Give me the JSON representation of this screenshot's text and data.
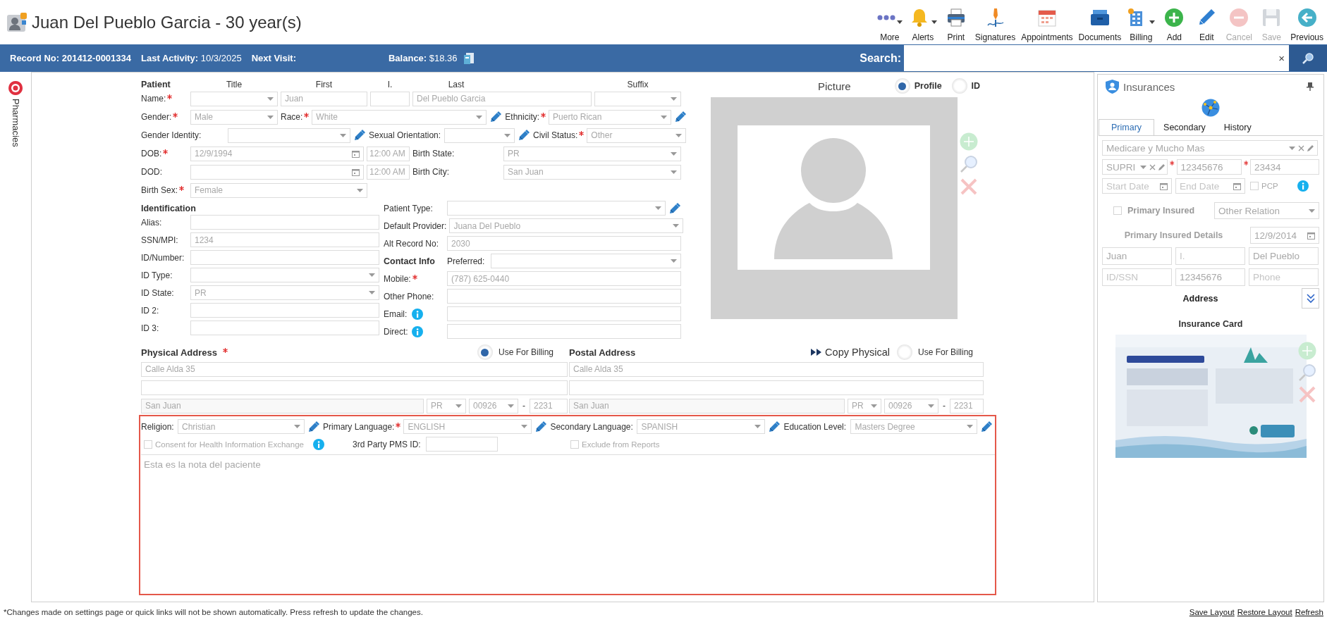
{
  "fields_disabled": true,
  "header": {
    "title": "Juan Del Pueblo Garcia - 30 year(s)"
  },
  "toolbar": [
    {
      "label": "More",
      "kind": "more",
      "dropdown": true,
      "disabled": false
    },
    {
      "label": "Alerts",
      "kind": "alerts",
      "dropdown": true,
      "disabled": false
    },
    {
      "label": "Print",
      "kind": "print",
      "dropdown": false,
      "disabled": false
    },
    {
      "label": "Signatures",
      "kind": "signatures",
      "dropdown": false,
      "disabled": false
    },
    {
      "label": "Appointments",
      "kind": "appointments",
      "dropdown": false,
      "disabled": false
    },
    {
      "label": "Documents",
      "kind": "documents",
      "dropdown": false,
      "disabled": false
    },
    {
      "label": "Billing",
      "kind": "billing",
      "dropdown": true,
      "disabled": false
    },
    {
      "label": "Add",
      "kind": "add",
      "dropdown": false,
      "disabled": false
    },
    {
      "label": "Edit",
      "kind": "edit",
      "dropdown": false,
      "disabled": false
    },
    {
      "label": "Cancel",
      "kind": "cancel",
      "dropdown": false,
      "disabled": true
    },
    {
      "label": "Save",
      "kind": "save",
      "dropdown": false,
      "disabled": true
    },
    {
      "label": "Previous",
      "kind": "previous",
      "dropdown": false,
      "disabled": false
    }
  ],
  "info_bar": {
    "record": {
      "label": "Record No:",
      "value": "201412-0001334"
    },
    "last_activity": {
      "label": "Last Activity:",
      "value": "10/3/2025"
    },
    "next_visit": {
      "label": "Next Visit:"
    },
    "balance": {
      "label": "Balance:",
      "value": "$18.36"
    },
    "search": {
      "label": "Search:",
      "clear": "×"
    }
  },
  "side_rail": {
    "label": "Pharmacies"
  },
  "patient": {
    "heading": "Patient",
    "columns": [
      "Title",
      "First",
      "I.",
      "Last",
      "Suffix"
    ],
    "name": {
      "label": "Name:",
      "required": true,
      "fields": [
        {
          "kind": "select"
        },
        {
          "kind": "input",
          "value": "Juan"
        },
        {
          "kind": "input"
        },
        {
          "kind": "input",
          "value": "Del Pueblo Garcia"
        },
        {
          "kind": "select"
        }
      ]
    },
    "rows": [
      [
        {
          "kind": "label",
          "text": "Gender:",
          "required": true
        },
        {
          "kind": "select",
          "value": "Male"
        },
        {
          "kind": "label",
          "text": "Race:",
          "required": true
        },
        {
          "kind": "select",
          "value": "White"
        },
        {
          "kind": "edit"
        },
        {
          "kind": "label",
          "text": "Ethnicity:",
          "required": true
        },
        {
          "kind": "select",
          "value": "Puerto Rican"
        },
        {
          "kind": "edit"
        }
      ],
      [
        {
          "kind": "label",
          "text": "Gender Identity:",
          "required": false
        },
        {
          "kind": "select"
        },
        {
          "kind": "edit"
        },
        {
          "kind": "label",
          "text": "Sexual Orientation:",
          "required": false
        },
        {
          "kind": "select"
        },
        {
          "kind": "edit"
        },
        {
          "kind": "label",
          "text": "Civil Status:",
          "required": true
        },
        {
          "kind": "select",
          "value": "Other"
        }
      ],
      [
        {
          "kind": "label",
          "text": "DOB:",
          "required": true
        },
        {
          "kind": "date",
          "value": "12/9/1994"
        },
        {
          "kind": "time",
          "value": "12:00 AM"
        },
        {
          "kind": "label",
          "text": "Birth State:",
          "required": false
        },
        {
          "kind": "select",
          "value": "PR"
        }
      ],
      [
        {
          "kind": "label",
          "text": "DOD:",
          "required": false
        },
        {
          "kind": "date"
        },
        {
          "kind": "time",
          "value": "12:00 AM"
        },
        {
          "kind": "label",
          "text": "Birth City:",
          "required": false
        },
        {
          "kind": "select",
          "value": "San Juan"
        }
      ],
      [
        {
          "kind": "label",
          "text": "Birth Sex:",
          "required": true
        },
        {
          "kind": "select",
          "value": "Female"
        }
      ]
    ]
  },
  "identification": {
    "heading": "Identification",
    "rows": [
      [
        {
          "kind": "label",
          "text": "Alias:",
          "required": false
        },
        {
          "kind": "input"
        }
      ],
      [
        {
          "kind": "label",
          "text": "SSN/MPI:",
          "required": false
        },
        {
          "kind": "input",
          "value": "1234"
        }
      ],
      [
        {
          "kind": "label",
          "text": "ID/Number:",
          "required": false
        },
        {
          "kind": "input"
        }
      ],
      [
        {
          "kind": "label",
          "text": "ID Type:",
          "required": false
        },
        {
          "kind": "select"
        }
      ],
      [
        {
          "kind": "label",
          "text": "ID State:",
          "required": false
        },
        {
          "kind": "select",
          "value": "PR"
        }
      ],
      [
        {
          "kind": "label",
          "text": "ID 2:",
          "required": false
        },
        {
          "kind": "input"
        }
      ],
      [
        {
          "kind": "label",
          "text": "ID 3:",
          "required": false
        },
        {
          "kind": "input"
        }
      ]
    ]
  },
  "provider_contact": {
    "rows": [
      [
        {
          "kind": "label",
          "text": "Patient Type:",
          "required": false
        },
        {
          "kind": "select"
        },
        {
          "kind": "edit"
        }
      ],
      [
        {
          "kind": "label",
          "text": "Default Provider:",
          "required": false
        },
        {
          "kind": "select",
          "value": "Juana Del Pueblo"
        }
      ],
      [
        {
          "kind": "label",
          "text": "Alt Record No:",
          "required": false
        },
        {
          "kind": "input",
          "value": "2030"
        }
      ],
      [
        {
          "kind": "heading",
          "text": "Contact Info"
        },
        {
          "kind": "label",
          "text": "Preferred:",
          "required": false
        },
        {
          "kind": "select"
        }
      ],
      [
        {
          "kind": "label",
          "text": "Mobile:",
          "required": true
        },
        {
          "kind": "input",
          "value": "(787) 625-0440"
        }
      ],
      [
        {
          "kind": "label",
          "text": "Other Phone:",
          "required": false
        },
        {
          "kind": "input"
        }
      ],
      [
        {
          "kind": "label",
          "text": "Email:",
          "required": false
        },
        {
          "kind": "info"
        },
        {
          "kind": "input"
        }
      ],
      [
        {
          "kind": "label",
          "text": "Direct:",
          "required": false
        },
        {
          "kind": "info"
        },
        {
          "kind": "input"
        }
      ]
    ]
  },
  "picture": {
    "title": "Picture",
    "options": [
      {
        "label": "Profile",
        "selected": true
      },
      {
        "label": "ID",
        "selected": false
      }
    ]
  },
  "physical_address": {
    "title": "Physical Address",
    "required": true,
    "use_for_billing": {
      "label": "Use For Billing",
      "selected": true
    },
    "line1": "Calle Alda 35",
    "city": "San Juan",
    "state": "PR",
    "zip": "00926",
    "zip_separator": "-",
    "zip_ext": "2231"
  },
  "postal_address": {
    "title": "Postal Address",
    "required": false,
    "copy": "Copy Physical",
    "use_for_billing": {
      "label": "Use For Billing",
      "selected": false
    },
    "line1": "Calle Alda 35",
    "city": "San Juan",
    "state": "PR",
    "zip": "00926",
    "zip_separator": "-",
    "zip_ext": "2231"
  },
  "additional": {
    "selectors": [
      {
        "kind": "label",
        "text": "Religion:",
        "required": false
      },
      {
        "kind": "select",
        "value": "Christian"
      },
      {
        "kind": "edit"
      },
      {
        "kind": "label",
        "text": "Primary Language:",
        "required": true
      },
      {
        "kind": "select",
        "value": "ENGLISH"
      },
      {
        "kind": "edit"
      },
      {
        "kind": "label",
        "text": "Secondary Language:",
        "required": false
      },
      {
        "kind": "select",
        "value": "SPANISH"
      },
      {
        "kind": "edit"
      },
      {
        "kind": "label",
        "text": "Education Level:",
        "required": false
      },
      {
        "kind": "select",
        "value": "Masters Degree"
      },
      {
        "kind": "edit"
      }
    ],
    "options": [
      {
        "kind": "checkbox",
        "text": "Consent for Health Information Exchange",
        "checked": false
      },
      {
        "kind": "info"
      },
      {
        "kind": "label",
        "text": "3rd Party PMS ID:",
        "required": false
      },
      {
        "kind": "input"
      },
      {
        "kind": "checkbox",
        "text": "Exclude from Reports",
        "checked": false
      }
    ],
    "notes": "Esta es la nota del paciente"
  },
  "insurances": {
    "title": "Insurances",
    "tabs": [
      {
        "label": "Primary",
        "selected": true
      },
      {
        "label": "Secondary",
        "selected": false
      },
      {
        "label": "History",
        "selected": false
      }
    ],
    "payer": "Medicare y Mucho Mas",
    "plan": "SUPRI",
    "ids": [
      {
        "value": "12345676",
        "required": true
      },
      {
        "value": "23434",
        "required": true
      }
    ],
    "start_date": "Start Date",
    "end_date": "End Date",
    "pcp": {
      "label": "PCP",
      "checked": false
    },
    "primary_insured": {
      "label": "Primary Insured",
      "checked": false
    },
    "relation": "Other Relation",
    "details_title": "Primary Insured Details",
    "insured_dob": "12/9/2014",
    "insured_fields": [
      {
        "value": "Juan"
      },
      {
        "placeholder": "I."
      },
      {
        "value": "Del Pueblo"
      },
      {
        "placeholder": "ID/SSN"
      },
      {
        "value": "12345676"
      },
      {
        "placeholder": "Phone"
      }
    ],
    "address_label": "Address",
    "card_title": "Insurance Card"
  },
  "footer": {
    "note": "*Changes made on settings page or quick links will not be shown automatically. Press refresh to update the changes.",
    "links": [
      "Save Layout",
      "Restore Layout",
      "Refresh"
    ]
  }
}
